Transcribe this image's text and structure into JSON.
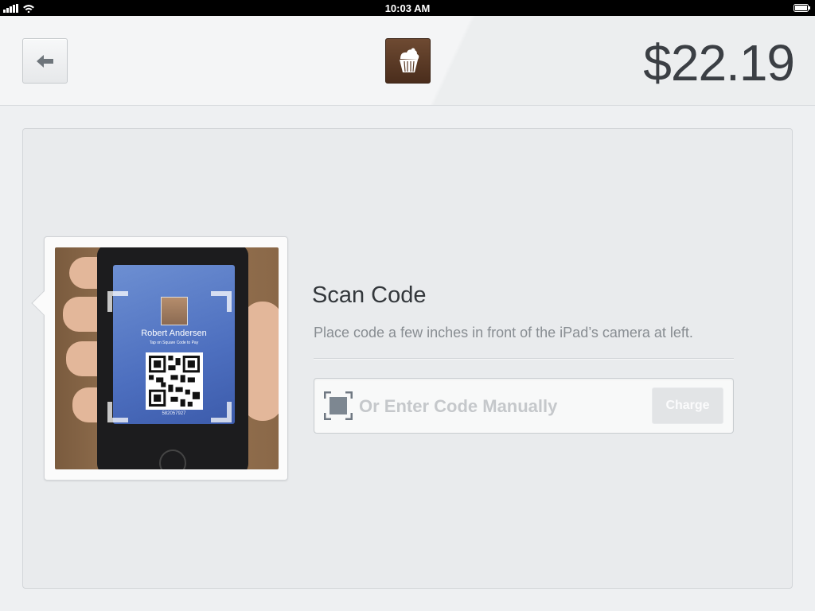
{
  "status_bar": {
    "time": "10:03 AM",
    "icons": [
      "signal-icon",
      "wifi-icon",
      "battery-icon"
    ]
  },
  "header": {
    "back_icon": "arrow-left-icon",
    "logo_icon": "cupcake-icon",
    "amount": "$22.19"
  },
  "camera": {
    "card_name": "Robert Andersen",
    "card_subtitle": "Tap on Square Code to Pay",
    "card_code": "582057927"
  },
  "scan": {
    "title": "Scan Code",
    "description": "Place code a few inches in front of the iPad’s camera at left.",
    "input_placeholder": "Or Enter Code Manually",
    "input_value": "",
    "charge_label": "Charge"
  },
  "colors": {
    "amount_text": "#3b3f44",
    "logo_bg": "#5a3a25",
    "background": "#eef0f2",
    "panel": "#e9ebed"
  }
}
